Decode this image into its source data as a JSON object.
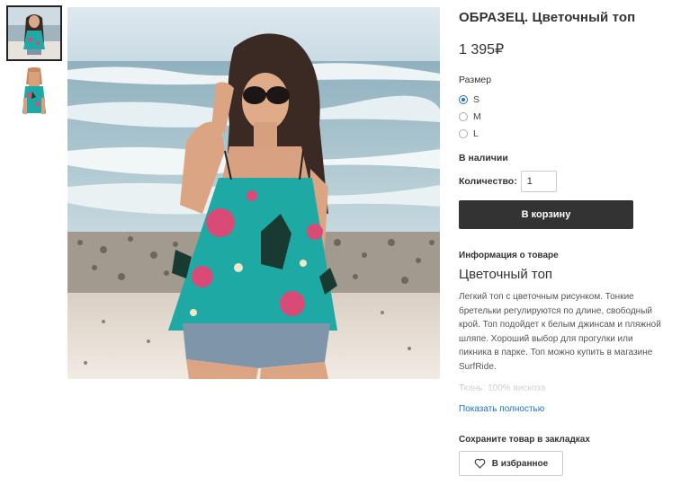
{
  "product": {
    "title": "ОБРАЗЕЦ. Цветочный топ",
    "price": "1 395₽"
  },
  "size": {
    "label": "Размер",
    "options": [
      {
        "label": "S",
        "selected": true
      },
      {
        "label": "M",
        "selected": false
      },
      {
        "label": "L",
        "selected": false
      }
    ]
  },
  "availability": "В наличии",
  "quantity": {
    "label": "Количество:",
    "value": "1"
  },
  "cart_button": "В корзину",
  "info": {
    "heading": "Информация о товаре",
    "name": "Цветочный топ",
    "description": "Легкий топ с цветочным рисунком. Тонкие бретельки регулируются по длине, свободный крой. Топ подойдет к белым джинсам и пляжной шляпе. Хороший выбор для прогулки или пикника в парке. Топ можно купить в магазине SurfRide.",
    "fabric": "Ткань: 100% вискоза",
    "show_more": "Показать полностью"
  },
  "bookmarks": {
    "heading": "Сохраните товар в закладках",
    "button": "В избранное",
    "icon": "heart-icon"
  },
  "colors": {
    "accent": "#1a73c8",
    "button_dark": "#333333",
    "top_teal": "#1fa9a5"
  }
}
